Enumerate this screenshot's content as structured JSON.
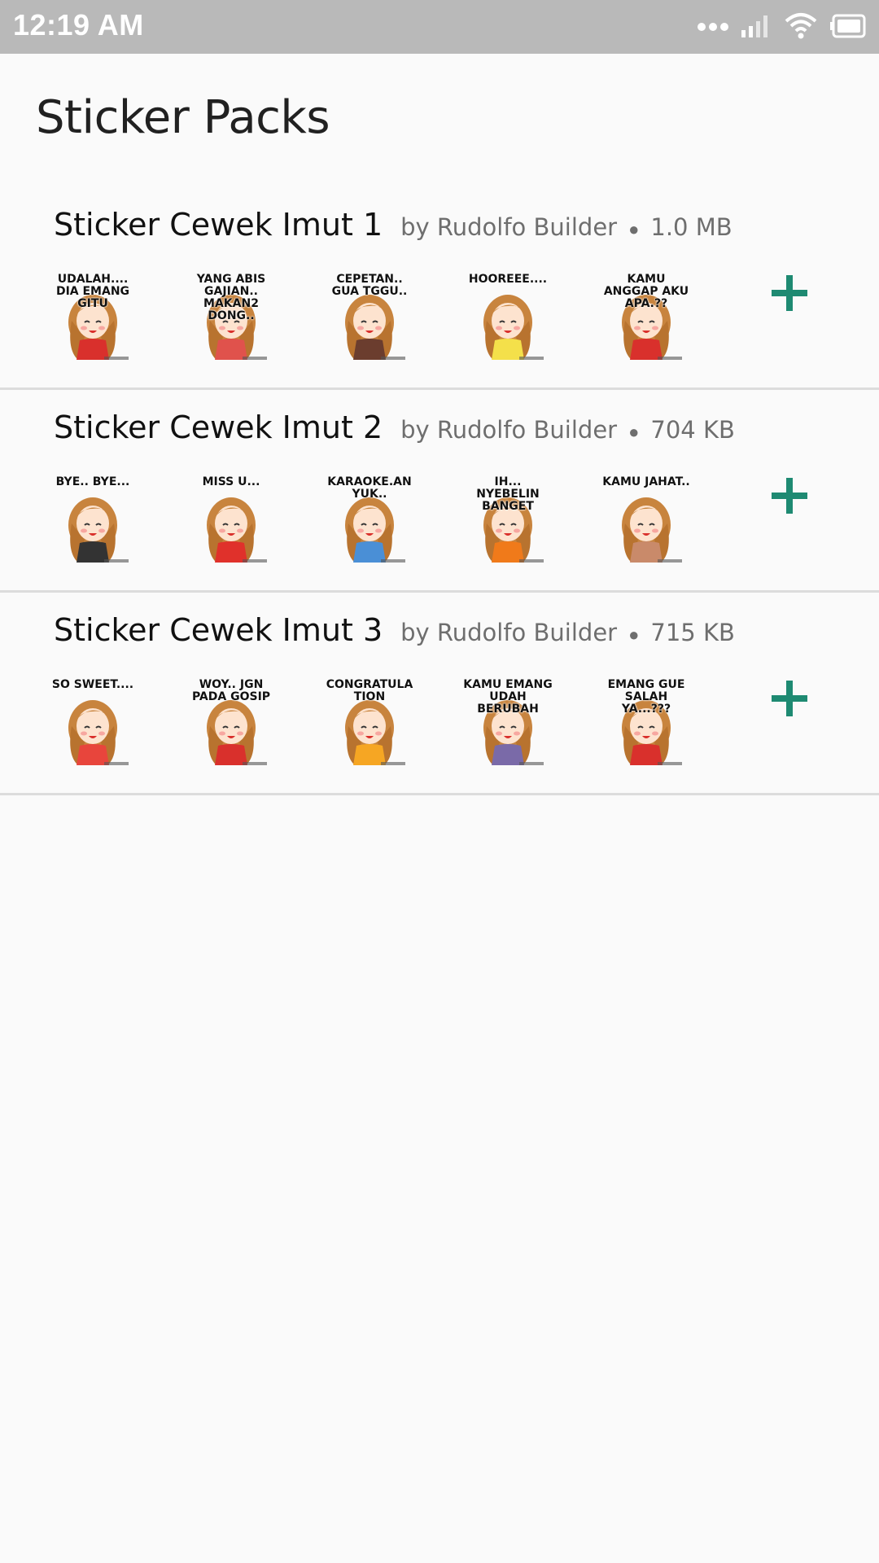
{
  "status_bar": {
    "time": "12:19 AM",
    "icons": [
      "more-dots-icon",
      "signal-icon",
      "wifi-icon",
      "battery-icon"
    ]
  },
  "page": {
    "title": "Sticker Packs"
  },
  "colors": {
    "accent": "#1e8a72",
    "status_bar": "#b9b9b9",
    "background": "#fafafa"
  },
  "packs": [
    {
      "name": "Sticker Cewek Imut 1",
      "publisher": "by Rudolfo Builder",
      "size": "1.0 MB",
      "add_icon": "plus-icon",
      "stickers": [
        {
          "caption": "UDALAH.... DIA EMANG GITU",
          "accent": "#d9302c"
        },
        {
          "caption": "YANG ABIS GAJIAN.. MAKAN2 DONG..",
          "accent": "#e0524c"
        },
        {
          "caption": "CEPETAN.. GUA TGGU..",
          "accent": "#6b3d2e"
        },
        {
          "caption": "HOOREEE....",
          "accent": "#f4e04a"
        },
        {
          "caption": "KAMU ANGGAP AKU APA.??",
          "accent": "#d9302c"
        }
      ]
    },
    {
      "name": "Sticker Cewek Imut 2",
      "publisher": "by Rudolfo Builder",
      "size": "704 KB",
      "add_icon": "plus-icon",
      "stickers": [
        {
          "caption": "BYE.. BYE...",
          "accent": "#333333"
        },
        {
          "caption": "MISS U...",
          "accent": "#e0312b"
        },
        {
          "caption": "KARAOKE.AN YUK..",
          "accent": "#4a8fd6"
        },
        {
          "caption": "IH... NYEBELIN BANGET",
          "accent": "#f07a1a"
        },
        {
          "caption": "KAMU JAHAT..",
          "accent": "#c98a6a"
        }
      ]
    },
    {
      "name": "Sticker Cewek Imut 3",
      "publisher": "by Rudolfo Builder",
      "size": "715 KB",
      "add_icon": "plus-icon",
      "stickers": [
        {
          "caption": "SO SWEET....",
          "accent": "#e8453c"
        },
        {
          "caption": "WOY.. JGN PADA GOSIP",
          "accent": "#d9302c"
        },
        {
          "caption": "CONGRATULATION",
          "accent": "#f6a623"
        },
        {
          "caption": "KAMU EMANG UDAH BERUBAH",
          "accent": "#7a6aa8"
        },
        {
          "caption": "EMANG GUE SALAH YA...???",
          "accent": "#d9302c"
        }
      ]
    }
  ]
}
